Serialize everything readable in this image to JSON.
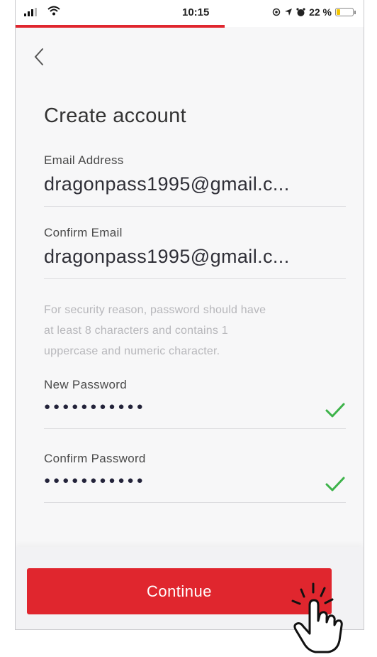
{
  "status_bar": {
    "time": "10:15",
    "battery": "22 %",
    "battery_level": 0.22,
    "icons": [
      "signal-icon",
      "wifi-icon",
      "location-icon",
      "alarm-icon",
      "battery-icon"
    ]
  },
  "progress": {
    "fraction": 0.6,
    "color": "#e0262e"
  },
  "header": {
    "back_icon": "chevron-left-icon"
  },
  "page": {
    "title": "Create account"
  },
  "form": {
    "email": {
      "label": "Email Address",
      "value": "dragonpass1995@gmail.c..."
    },
    "confirm_email": {
      "label": "Confirm Email",
      "value": "dragonpass1995@gmail.c..."
    },
    "hint_lines": [
      "For security reason, password should have",
      "at least 8 characters and contains 1",
      "uppercase and numeric character."
    ],
    "new_password": {
      "label": "New Password",
      "value": "●●●●●●●●●●●",
      "valid": true
    },
    "confirm_password": {
      "label": "Confirm Password",
      "value": "●●●●●●●●●●●",
      "valid": true
    }
  },
  "footer": {
    "continue_label": "Continue"
  },
  "colors": {
    "accent": "#e0262e",
    "check": "#3db34a"
  }
}
